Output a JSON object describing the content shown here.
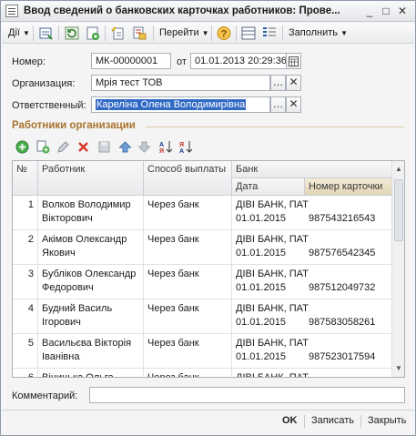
{
  "window": {
    "title": "Ввод сведений о банковских карточках работников: Прове...",
    "minimize": "_",
    "maximize": "□",
    "close": "✕"
  },
  "toolbar": {
    "actions_label": "Дії",
    "goto_label": "Перейти",
    "fill_label": "Заполнить"
  },
  "form": {
    "number_label": "Номер:",
    "number_value": "МК-00000001",
    "date_label": "от",
    "date_value": "01.01.2013 20:29:36",
    "org_label": "Организация:",
    "org_value": "Мрія тест ТОВ",
    "resp_label": "Ответственный:",
    "resp_value": "Кареліна Олена Володимирівна"
  },
  "section": {
    "title": "Работники организации"
  },
  "table": {
    "headers": {
      "num": "№",
      "worker": "Работник",
      "method": "Способ выплаты",
      "bank": "Банк",
      "date": "Дата",
      "card": "Номер карточки"
    },
    "rows": [
      {
        "n": "1",
        "worker1": "Волков Володимир",
        "worker2": "Вікторович",
        "method": "Через банк",
        "bank": "ДІВІ БАНК, ПАТ",
        "date": "01.01.2015",
        "card": "987543216543"
      },
      {
        "n": "2",
        "worker1": "Акімов Олександр",
        "worker2": "Якович",
        "method": "Через банк",
        "bank": "ДІВІ БАНК, ПАТ",
        "date": "01.01.2015",
        "card": "987576542345"
      },
      {
        "n": "3",
        "worker1": "Бубліков Олександр",
        "worker2": "Федорович",
        "method": "Через банк",
        "bank": "ДІВІ БАНК, ПАТ",
        "date": "01.01.2015",
        "card": "987512049732"
      },
      {
        "n": "4",
        "worker1": "Будний Василь",
        "worker2": "Ігорович",
        "method": "Через банк",
        "bank": "ДІВІ БАНК, ПАТ",
        "date": "01.01.2015",
        "card": "987583058261"
      },
      {
        "n": "5",
        "worker1": "Васильєва Вікторія",
        "worker2": "Іванівна",
        "method": "Через банк",
        "bank": "ДІВІ БАНК, ПАТ",
        "date": "01.01.2015",
        "card": "987523017594"
      },
      {
        "n": "6",
        "worker1": "Віницька Ольга",
        "worker2": "",
        "method": "Через банк",
        "bank": "ДІВІ БАНК, ПАТ",
        "date": "",
        "card": ""
      }
    ]
  },
  "comment": {
    "label": "Комментарий:",
    "value": ""
  },
  "footer": {
    "ok": "OK",
    "save": "Записать",
    "close": "Закрыть"
  },
  "colors": {
    "section_title": "#a9722b",
    "selection": "#316ac5",
    "active_header": "#e2d5b5"
  }
}
